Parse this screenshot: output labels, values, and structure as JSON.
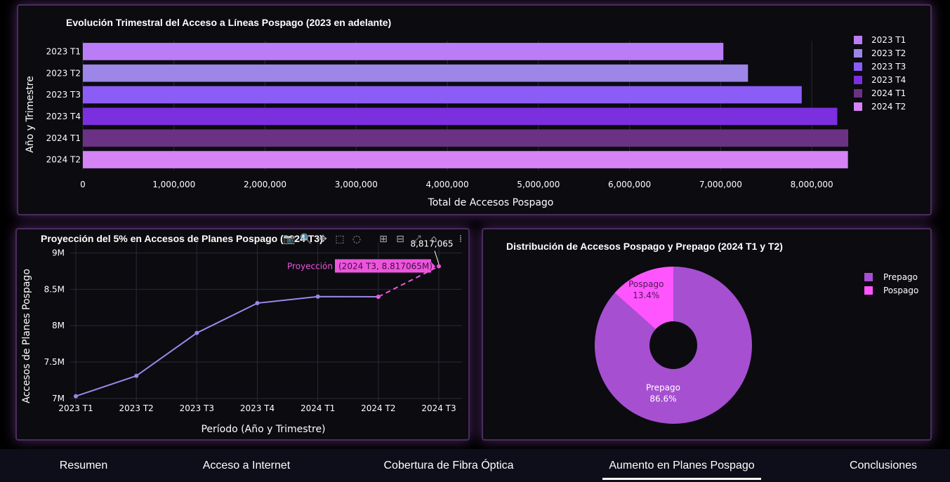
{
  "tabs": [
    {
      "label": "Resumen",
      "active": false
    },
    {
      "label": "Acceso a Internet",
      "active": false
    },
    {
      "label": "Cobertura de Fibra Óptica",
      "active": false
    },
    {
      "label": "Aumento en Planes Pospago",
      "active": true
    },
    {
      "label": "Conclusiones",
      "active": false
    }
  ],
  "modebar": [
    "camera-icon",
    "zoom-icon",
    "pan-icon",
    "box-select-icon",
    "lasso-icon",
    "zoom-in-icon",
    "zoom-out-icon",
    "autoscale-icon",
    "reset-axes-icon",
    "plotly-logo-icon"
  ],
  "chart_data": [
    {
      "type": "bar",
      "orientation": "horizontal",
      "title": "Evolución Trimestral del Acceso a Líneas Pospago (2023 en adelante)",
      "xlabel": "Total de Accesos Pospago",
      "ylabel": "Año y Trimestre",
      "categories": [
        "2023 T1",
        "2023 T2",
        "2023 T3",
        "2023 T4",
        "2024 T1",
        "2024 T2"
      ],
      "values": [
        7030000,
        7300000,
        7890000,
        8280000,
        8400000,
        8397205
      ],
      "colors": [
        "#bb7cf8",
        "#9d86e8",
        "#8c5cf6",
        "#7b2fdf",
        "#6b3184",
        "#d583f5"
      ],
      "xlim": [
        0,
        8500000
      ],
      "xticks": [
        0,
        1000000,
        2000000,
        3000000,
        4000000,
        5000000,
        6000000,
        7000000,
        8000000
      ],
      "xtick_labels": [
        "0",
        "1,000,000",
        "2,000,000",
        "3,000,000",
        "4,000,000",
        "5,000,000",
        "6,000,000",
        "7,000,000",
        "8,000,000"
      ],
      "legend": [
        "2023 T1",
        "2023 T2",
        "2023 T3",
        "2023 T4",
        "2024 T1",
        "2024 T2"
      ],
      "legend_position": "top-right"
    },
    {
      "type": "line",
      "title": "Proyección del 5% en Accesos de Planes Pospago (2024 T3)",
      "xlabel": "Período (Año y Trimestre)",
      "ylabel": "Accesos de Planes Pospago",
      "x": [
        "2023 T1",
        "2023 T2",
        "2023 T3",
        "2023 T4",
        "2024 T1",
        "2024 T2",
        "2024 T3"
      ],
      "series": [
        {
          "values": [
            7030000,
            7310000,
            7900000,
            8310000,
            8400000,
            8397205
          ],
          "color": "#9d86e8",
          "dash": "solid"
        },
        {
          "name": "Proyección",
          "x": [
            "2024 T2",
            "2024 T3"
          ],
          "values": [
            8397205,
            8817065
          ],
          "color": "#ee55dd",
          "dash": "dash"
        }
      ],
      "ylim": [
        6950000,
        9150000
      ],
      "yticks": [
        7000000,
        7500000,
        8000000,
        8500000,
        9000000
      ],
      "ytick_labels": [
        "7M",
        "7.5M",
        "8M",
        "8.5M",
        "9M"
      ],
      "annotation": "8,817,065",
      "hover_label": "Proyección",
      "hover_value": "(2024 T3, 8.817065M)",
      "grid": true
    },
    {
      "type": "pie",
      "hole": true,
      "title": "Distribución de Accesos Pospago y Prepago (2024 T1 y T2)",
      "slices": [
        {
          "label": "Prepago",
          "percent": 86.6,
          "percent_label": "86.6%",
          "color": "#a64fd1"
        },
        {
          "label": "Pospago",
          "percent": 13.4,
          "percent_label": "13.4%",
          "color": "#ff55ff"
        }
      ],
      "legend": [
        "Prepago",
        "Pospago"
      ],
      "legend_position": "top-right"
    }
  ]
}
